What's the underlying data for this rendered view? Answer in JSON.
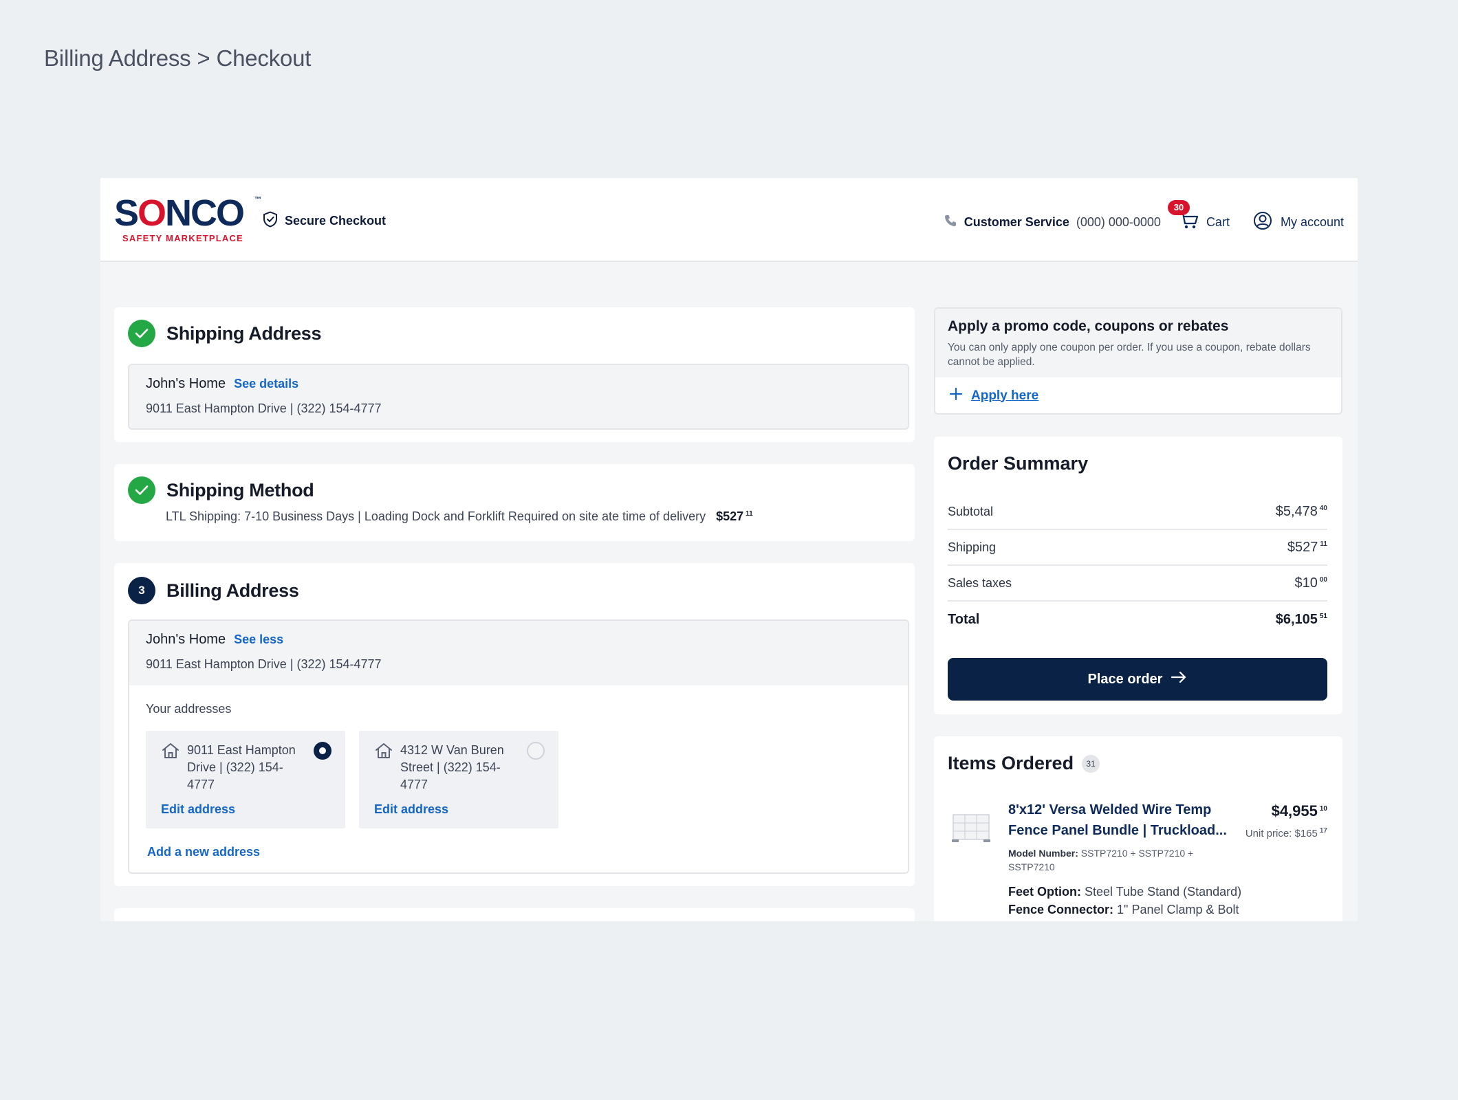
{
  "breadcrumb": "Billing Address > Checkout",
  "header": {
    "logo_main_a": "S",
    "logo_main_o": "O",
    "logo_main_b": "NCO",
    "logo_tm": "™",
    "logo_sub": "SAFETY MARKETPLACE",
    "secure_checkout": "Secure Checkout",
    "customer_service_label": "Customer Service",
    "customer_service_phone": "(000) 000-0000",
    "cart_count": "30",
    "cart_label": "Cart",
    "account_label": "My account"
  },
  "shipping_address": {
    "title": "Shipping Address",
    "name": "John's Home",
    "link": "See details",
    "line": "9011 East Hampton Drive | (322) 154-4777"
  },
  "shipping_method": {
    "title": "Shipping Method",
    "line": "LTL Shipping: 7-10 Business Days | Loading Dock and Forklift Required on site ate time of delivery",
    "price_main": "$527",
    "price_cents": "11"
  },
  "billing_address": {
    "step": "3",
    "title": "Billing Address",
    "name": "John's Home",
    "link": "See less",
    "line": "9011 East Hampton Drive | (322) 154-4777",
    "your_addresses_label": "Your addresses",
    "addresses": [
      {
        "text": "9011 East Hampton Drive | (322) 154-4777",
        "edit": "Edit address",
        "selected": true
      },
      {
        "text": "4312 W Van Buren Street | (322) 154-4777",
        "edit": "Edit address",
        "selected": false
      }
    ],
    "add_new": "Add a new address"
  },
  "promo": {
    "title": "Apply a promo code, coupons or rebates",
    "desc": "You can only apply one coupon per order. If you use a coupon, rebate dollars cannot be applied.",
    "apply": "Apply here"
  },
  "summary": {
    "title": "Order Summary",
    "rows": [
      {
        "label": "Subtotal",
        "main": "$5,478",
        "cents": "40"
      },
      {
        "label": "Shipping",
        "main": "$527",
        "cents": "11"
      },
      {
        "label": "Sales taxes",
        "main": "$10",
        "cents": "00"
      },
      {
        "label": "Total",
        "main": "$6,105",
        "cents": "51"
      }
    ],
    "place_order": "Place order"
  },
  "items": {
    "title": "Items Ordered",
    "count": "31",
    "product": {
      "name_line1": "8'x12' Versa Welded Wire Temp",
      "name_line2": "Fence Panel Bundle | Truckload...",
      "price_main": "$4,955",
      "price_cents": "10",
      "unit_label": "Unit price: $165",
      "unit_cents": "17",
      "model_label": "Model Number:",
      "model_value": "SSTP7210 + SSTP7210 + SSTP7210",
      "feet_label": "Feet Option:",
      "feet_value": "Steel Tube Stand (Standard)",
      "connector_label": "Fence Connector:",
      "connector_value": "1\" Panel Clamp & Bolt"
    }
  },
  "colors": {
    "brand_navy": "#0b2247",
    "brand_red": "#d8142d",
    "link_blue": "#1466c9",
    "success_green": "#23a845"
  }
}
